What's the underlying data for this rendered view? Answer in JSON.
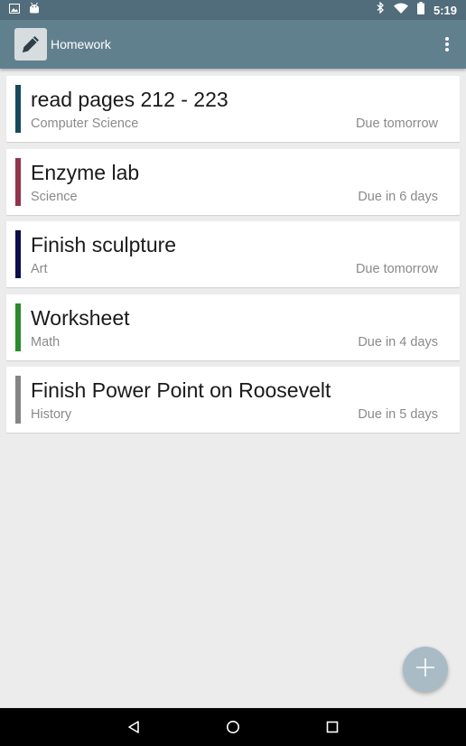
{
  "status_bar": {
    "time": "5:19",
    "icons": [
      "image-icon",
      "android-icon",
      "bluetooth-icon",
      "wifi-icon",
      "battery-icon"
    ]
  },
  "app_bar": {
    "title": "Homework",
    "logo_icon": "pencil-icon",
    "menu_icon": "overflow-menu-icon",
    "background": "#61808e"
  },
  "assignments": [
    {
      "title": "read pages 212 - 223",
      "subject": "Computer Science",
      "due": "Due tomorrow",
      "color": "#15495e"
    },
    {
      "title": "Enzyme lab",
      "subject": "Science",
      "due": "Due in 6 days",
      "color": "#93334b"
    },
    {
      "title": "Finish sculpture",
      "subject": "Art",
      "due": "Due tomorrow",
      "color": "#0b0d4c"
    },
    {
      "title": "Worksheet",
      "subject": "Math",
      "due": "Due in 4 days",
      "color": "#2c8a2e"
    },
    {
      "title": "Finish Power Point on Roosevelt",
      "subject": "History",
      "due": "Due in 5 days",
      "color": "#858585"
    }
  ],
  "fab": {
    "icon": "plus-icon",
    "color": "#a9bcc6"
  },
  "nav_bar": {
    "icons": [
      "back-icon",
      "home-icon",
      "recents-icon"
    ]
  }
}
